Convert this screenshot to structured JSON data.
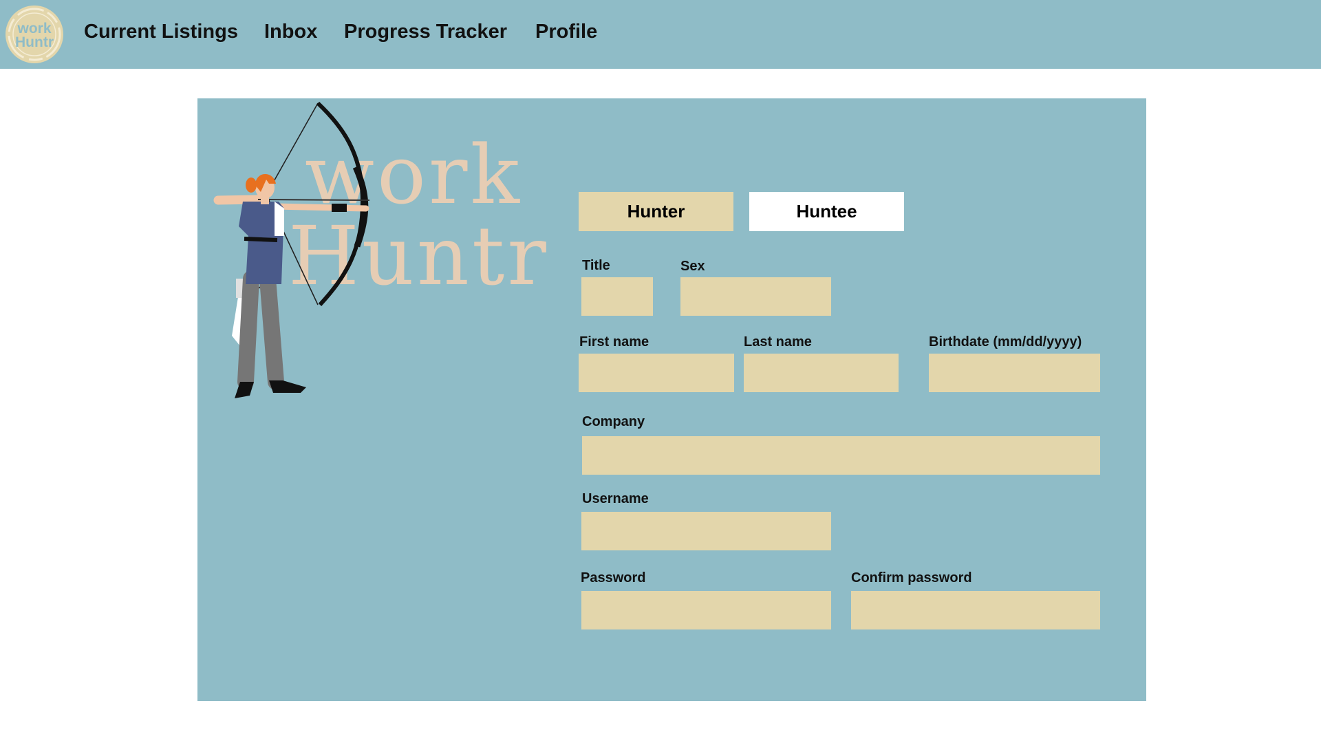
{
  "nav": {
    "logo_text_line1": "work",
    "logo_text_line2": "Huntr",
    "links": [
      "Current Listings",
      "Inbox",
      "Progress Tracker",
      "Profile"
    ]
  },
  "brand": {
    "line1": "work",
    "line2": "Huntr"
  },
  "form": {
    "roles": [
      "Hunter",
      "Huntee"
    ],
    "selected_role": "Hunter",
    "fields": {
      "title": {
        "label": "Title",
        "value": ""
      },
      "sex": {
        "label": "Sex",
        "value": ""
      },
      "first_name": {
        "label": "First name",
        "value": ""
      },
      "last_name": {
        "label": "Last name",
        "value": ""
      },
      "birthdate": {
        "label": "Birthdate (mm/dd/yyyy)",
        "value": ""
      },
      "company": {
        "label": "Company",
        "value": ""
      },
      "username": {
        "label": "Username",
        "value": ""
      },
      "password": {
        "label": "Password",
        "value": ""
      },
      "confirm_password": {
        "label": "Confirm password",
        "value": ""
      }
    }
  },
  "colors": {
    "primary": "#8fbcc7",
    "field": "#e3d6ab",
    "wordmark": "#e6cdb4",
    "background": "#ffffff"
  },
  "icons": [
    "logo-icon",
    "archer-illustration"
  ]
}
